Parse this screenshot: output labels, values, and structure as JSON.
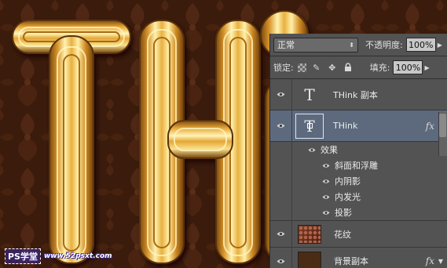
{
  "canvas": {
    "watermark_logo": "PS学堂",
    "watermark_url": "www.52psxt.com",
    "letters": "THi",
    "colors": {
      "background": "#3a1b0c",
      "gold_light": "#fff2b0",
      "gold_mid": "#e0a032",
      "gold_dark": "#7a4a10"
    }
  },
  "layers_panel": {
    "blend_mode": "正常",
    "opacity_label": "不透明度:",
    "opacity_value": "100%",
    "lock_label": "锁定:",
    "fill_label": "填充:",
    "fill_value": "100%",
    "layers": [
      {
        "name": "THink 副本",
        "thumb": "T",
        "type": "text",
        "selected": false,
        "fx": false
      },
      {
        "name": "THink",
        "thumb": "T",
        "type": "text",
        "selected": true,
        "fx": true
      }
    ],
    "effects_label": "效果",
    "effects": [
      "斜面和浮雕",
      "内阴影",
      "内发光",
      "投影"
    ],
    "image_layers": [
      {
        "name": "花纹",
        "type": "pattern",
        "fx": false
      },
      {
        "name": "背景副本",
        "type": "fill",
        "fx": true
      }
    ],
    "fx_symbol": "fx",
    "icons": [
      "eye-icon",
      "lock-transparent-icon",
      "lock-paint-icon",
      "lock-move-icon",
      "lock-all-icon",
      "chevron-down-icon"
    ],
    "selected_color": "#5d6a7e"
  }
}
